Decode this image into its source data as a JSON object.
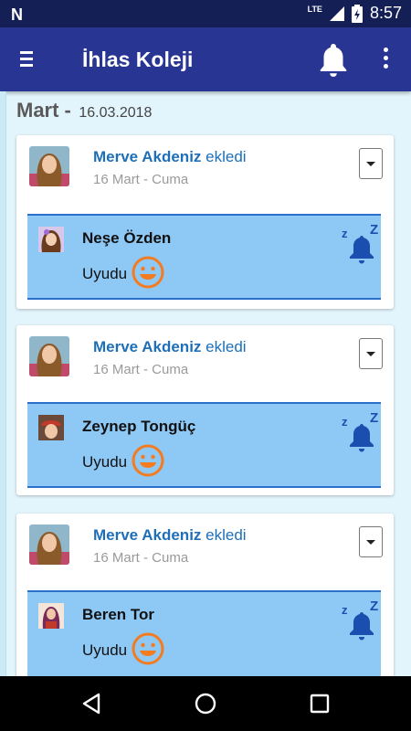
{
  "status_bar": {
    "time": "8:57",
    "network": "LTE",
    "battery_level": 0.75
  },
  "app_bar": {
    "title": "İhlas Koleji"
  },
  "section": {
    "month": "Mart -",
    "date": "16.03.2018"
  },
  "cards": [
    {
      "author": "Merve Akdeniz",
      "verb": "ekledi",
      "date": "16 Mart - Cuma",
      "child": "Neşe Özden",
      "status": "Uyudu"
    },
    {
      "author": "Merve Akdeniz",
      "verb": "ekledi",
      "date": "16 Mart - Cuma",
      "child": "Zeynep Tongüç",
      "status": "Uyudu"
    },
    {
      "author": "Merve Akdeniz",
      "verb": "ekledi",
      "date": "16 Mart - Cuma",
      "child": "Beren Tor",
      "status": "Uyudu"
    }
  ],
  "icons": {
    "menu": "hamburger-icon",
    "notifications": "bell-icon",
    "more": "more-vert-icon",
    "mood": "smiley-icon",
    "sleep": "sleep-bell-icon",
    "nav": [
      "back-icon",
      "home-icon",
      "recents-icon"
    ]
  },
  "colors": {
    "primary": "#283593",
    "status_bar": "#141f55",
    "accent_blue": "#1e6fb8",
    "entry_bg": "#8ec8f5",
    "smile": "#f47b20"
  }
}
